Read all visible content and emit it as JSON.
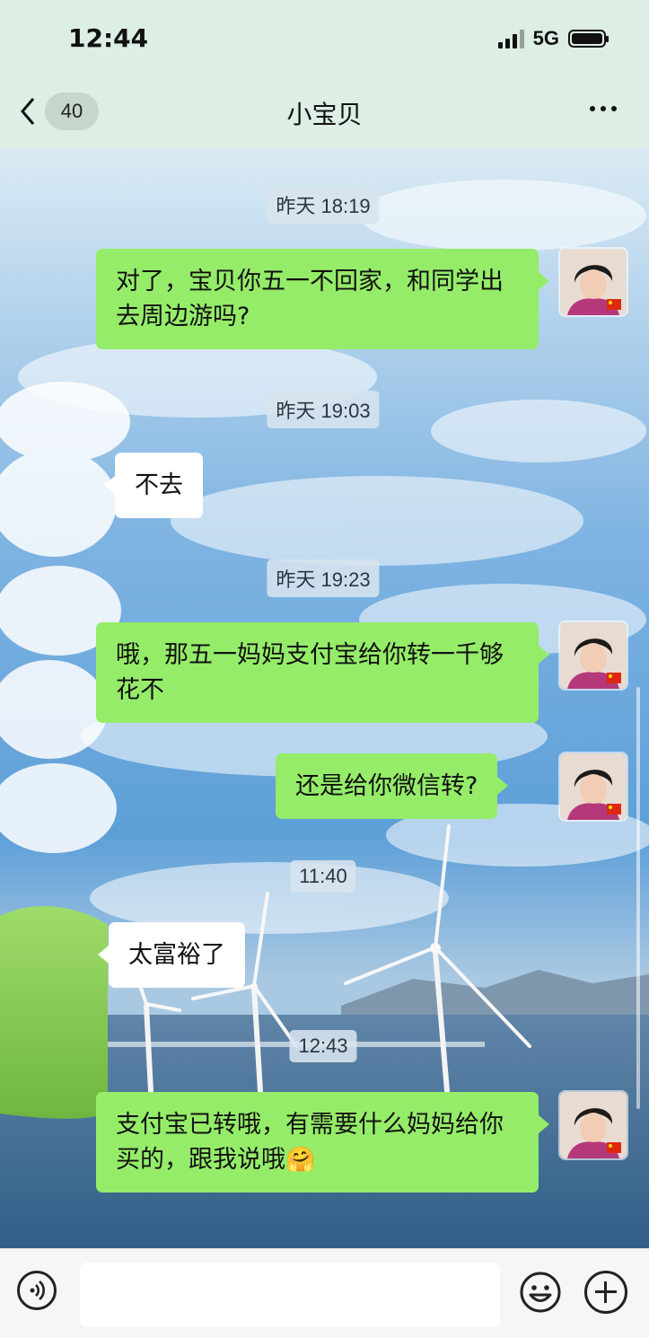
{
  "status_bar": {
    "time": "12:44",
    "network": "5G"
  },
  "nav": {
    "back_count": "40",
    "title": "小宝贝"
  },
  "messages": [
    {
      "type": "time",
      "text": "昨天 18:19"
    },
    {
      "type": "message",
      "from": "me",
      "text": "对了，宝贝你五一不回家，和同学出去周边游吗?"
    },
    {
      "type": "time",
      "text": "昨天 19:03"
    },
    {
      "type": "message",
      "from": "other",
      "text": "不去"
    },
    {
      "type": "time",
      "text": "昨天 19:23"
    },
    {
      "type": "message",
      "from": "me",
      "text": "哦，那五一妈妈支付宝给你转一千够花不"
    },
    {
      "type": "message",
      "from": "me",
      "text": "还是给你微信转?"
    },
    {
      "type": "time",
      "text": "11:40"
    },
    {
      "type": "message",
      "from": "other",
      "text": "太富裕了"
    },
    {
      "type": "time",
      "text": "12:43"
    },
    {
      "type": "message",
      "from": "me",
      "text": "支付宝已转哦，有需要什么妈妈给你买的，跟我说哦",
      "emoji": "🤗"
    }
  ],
  "input_bar": {
    "placeholder": ""
  },
  "icons": {
    "back": "chevron-left-icon",
    "more": "more-dots-icon",
    "voice": "voice-icon",
    "emoji": "emoji-icon",
    "plus": "plus-icon"
  },
  "colors": {
    "outgoing_bubble": "#95ec69",
    "incoming_bubble": "#ffffff",
    "header_bg": "#ddeee4",
    "input_bar_bg": "#f6f6f6"
  }
}
